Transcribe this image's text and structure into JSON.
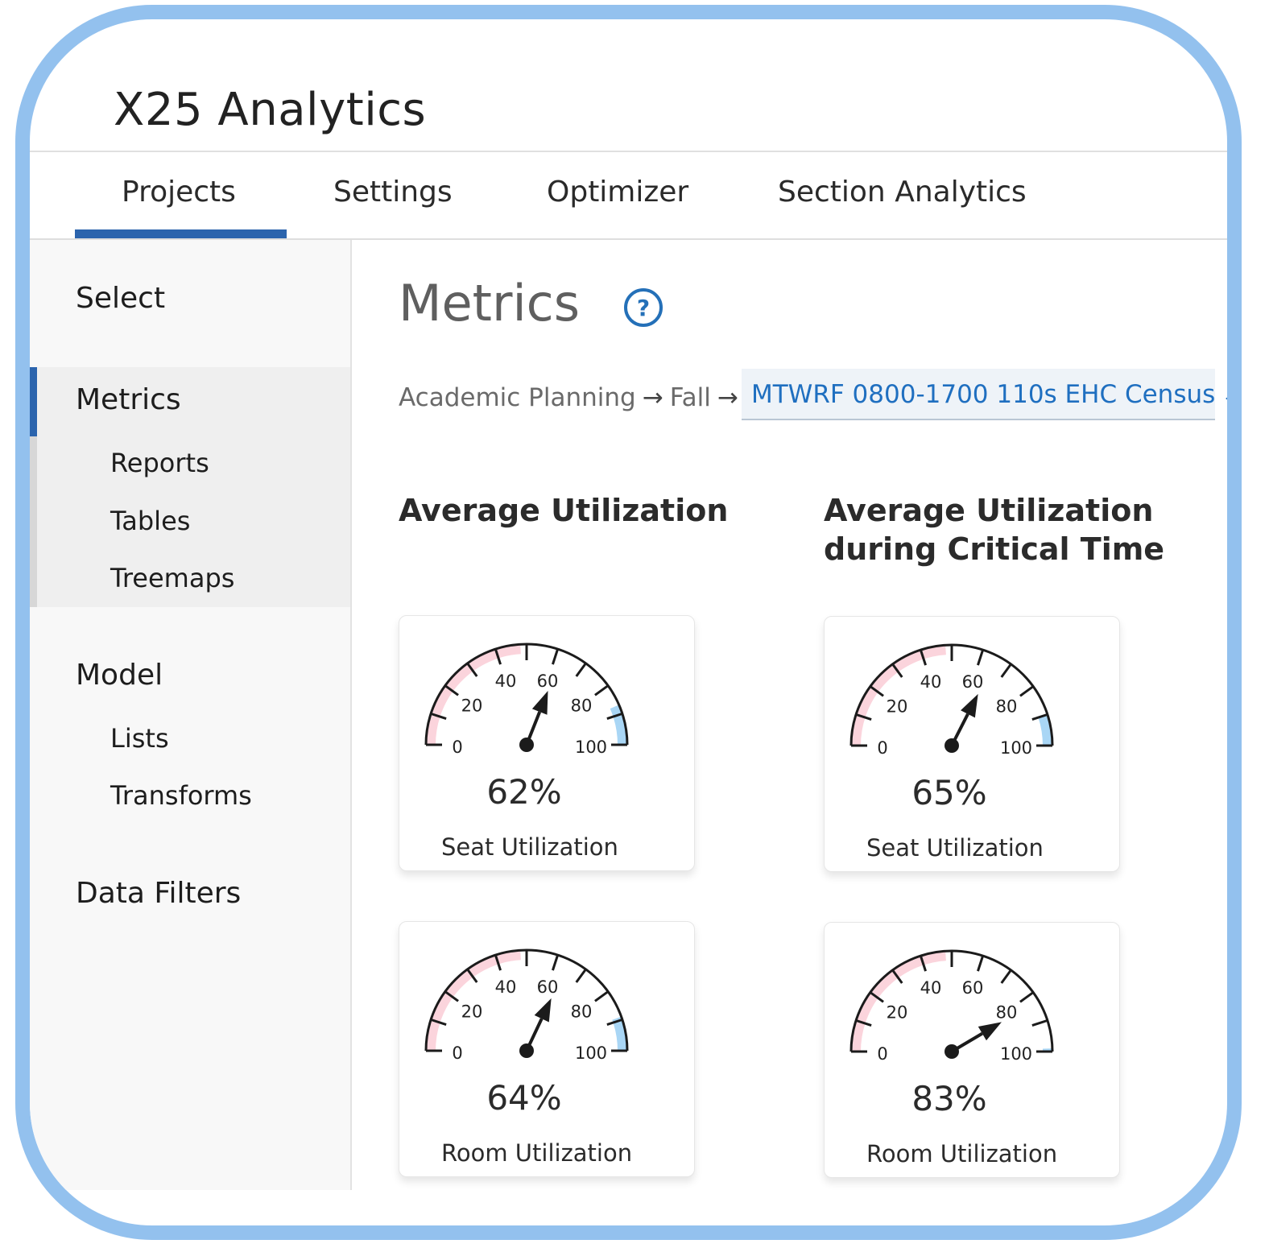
{
  "app": {
    "title": "X25 Analytics"
  },
  "tabs": [
    {
      "label": "Projects",
      "active": true
    },
    {
      "label": "Settings"
    },
    {
      "label": "Optimizer"
    },
    {
      "label": "Section Analytics"
    }
  ],
  "sidebar": {
    "select_heading": "Select",
    "metrics": {
      "label": "Metrics",
      "items": [
        "Reports",
        "Tables",
        "Treemaps"
      ]
    },
    "model": {
      "label": "Model",
      "items": [
        "Lists",
        "Transforms"
      ]
    },
    "data_filters": "Data Filters"
  },
  "main": {
    "title": "Metrics",
    "help_icon": "question-circle-icon",
    "breadcrumb": [
      "Academic Planning",
      "Fall"
    ],
    "breadcrumb_separator": "→",
    "selector_value": "MTWRF 0800-1700 110s EHC Census",
    "sections": [
      {
        "heading_lines": [
          "Average Utilization"
        ]
      },
      {
        "heading_lines": [
          "Average Utilization",
          "during Critical Time"
        ]
      }
    ]
  },
  "colors": {
    "accent": "#2b64ad",
    "link": "#1f6fc0",
    "gauge_low": "#fbd4dc",
    "gauge_high": "#a9d6f5",
    "frame": "#93c1ee"
  },
  "gauges": {
    "ticks": [
      0,
      20,
      40,
      60,
      80,
      100
    ],
    "items": [
      {
        "value": 62,
        "value_text": "62%",
        "label": "Seat Utilization"
      },
      {
        "value": 65,
        "value_text": "65%",
        "label": "Seat Utilization"
      },
      {
        "value": 64,
        "value_text": "64%",
        "label": "Room Utilization"
      },
      {
        "value": 83,
        "value_text": "83%",
        "label": "Room Utilization"
      }
    ]
  }
}
